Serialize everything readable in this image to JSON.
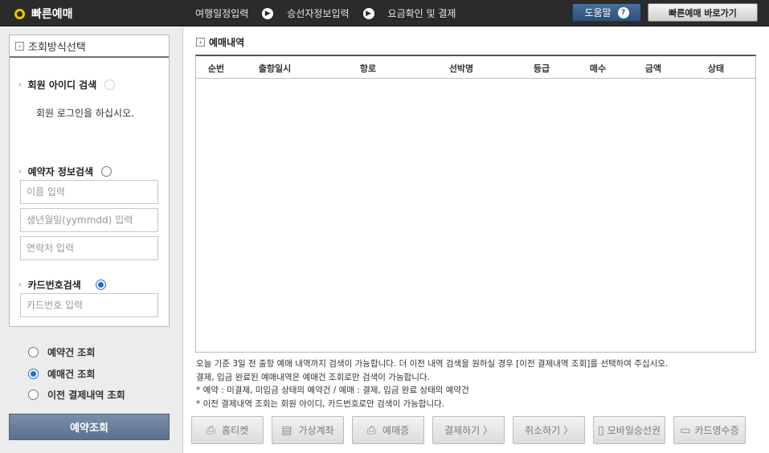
{
  "header": {
    "brand": "빠른예매",
    "steps": [
      "여행일정입력",
      "승선자정보입력",
      "요금확인 및 결제"
    ],
    "help_label": "도움말",
    "quick_label": "빠른예매 바로가기"
  },
  "sidebar": {
    "box_title": "조회방식선택",
    "member_search": {
      "label": "회원 아이디 검색",
      "message": "회원 로그인을 하십시오.",
      "checked": false,
      "disabled": true
    },
    "booker_search": {
      "label": "예약자 정보검색",
      "checked": false,
      "name_placeholder": "이름 입력",
      "birth_placeholder": "생년월일(yymmdd) 입력",
      "phone_placeholder": "연락처 입력"
    },
    "card_search": {
      "label": "카드번호검색",
      "checked": true,
      "card_placeholder": "카드번호 입력"
    },
    "options": [
      {
        "label": "예약건 조회",
        "checked": false
      },
      {
        "label": "예매건 조회",
        "checked": true
      },
      {
        "label": "이전 결제내역 조회",
        "checked": false
      }
    ],
    "search_button": "예약조회"
  },
  "main": {
    "title": "예매내역",
    "columns": [
      "순번",
      "출항일시",
      "항로",
      "선박명",
      "등급",
      "매수",
      "금액",
      "상태"
    ],
    "rows": [],
    "notes": [
      "오늘 기준 3일 전 출항 예매 내역까지 검색이 가능합니다. 더 이전 내역 검색을 원하실 경우 [이전 결제내역 조회]를 선택하여 주십시오.",
      "결제, 입금 완료된 예매내역은 예매건 조회로만 검색이 가능합니다.",
      "* 예약 : 미결제, 미입금 상태의 예약건 / 예매 : 결제, 입금 완료 상태의 예약건",
      "* 이전 결제내역 조회는 회원 아이디, 카드번호로만 검색이 가능합니다."
    ],
    "actions": [
      "홈티켓",
      "가상계좌",
      "예매증",
      "결제하기 〉",
      "취소하기 〉",
      "모바일승선권",
      "카드영수증"
    ]
  },
  "icons": {
    "brand": "circle-icon",
    "step_arrow": "chevron-right-icon",
    "help": "question-icon",
    "print": "printer-icon",
    "account": "monitor-icon",
    "mobile": "mobile-icon",
    "card": "card-icon"
  },
  "colors": {
    "topbar": "#2b2b2b",
    "brand_accent": "#f2c200",
    "help_button": "#3a5d88",
    "primary_button": "#6a7e9c",
    "radio_checked": "#1c6fd0"
  }
}
